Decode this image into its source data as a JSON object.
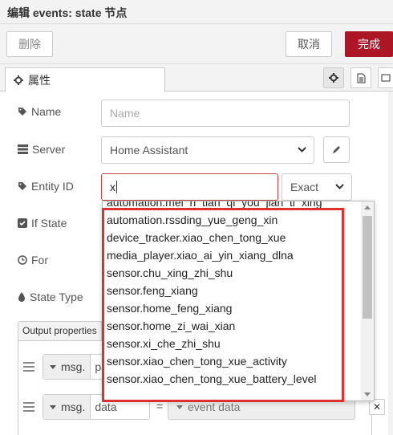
{
  "dialog": {
    "title": "编辑 events: state 节点"
  },
  "toolbar": {
    "delete_label": "删除",
    "cancel_label": "取消",
    "done_label": "完成"
  },
  "tabs": {
    "properties_label": "属性"
  },
  "form": {
    "name_label": "Name",
    "name_placeholder": "Name",
    "server_label": "Server",
    "server_value": "Home Assistant",
    "entity_label": "Entity ID",
    "entity_value": "x",
    "match_value": "Exact",
    "ifstate_label": "If State",
    "for_label": "For",
    "statetype_label": "State Type"
  },
  "output": {
    "header": "Output properties",
    "rows": [
      {
        "type": "msg.",
        "value": "pay",
        "eq": "=",
        "target": ""
      },
      {
        "type": "msg.",
        "value": "data",
        "eq": "=",
        "target": "event data"
      }
    ]
  },
  "autocomplete": {
    "items": [
      "automation.mei_ri_tian_qi_you_jian_ti_xing",
      "automation.rssding_yue_geng_xin",
      "device_tracker.xiao_chen_tong_xue",
      "media_player.xiao_ai_yin_xiang_dlna",
      "sensor.chu_xing_zhi_shu",
      "sensor.feng_xiang",
      "sensor.home_feng_xiang",
      "sensor.home_zi_wai_xian",
      "sensor.xi_che_zhi_shu",
      "sensor.xiao_chen_tong_xue_activity",
      "sensor.xiao_chen_tong_xue_battery_level"
    ]
  },
  "colors": {
    "primary": "#ad1625",
    "highlight": "#e03131"
  }
}
